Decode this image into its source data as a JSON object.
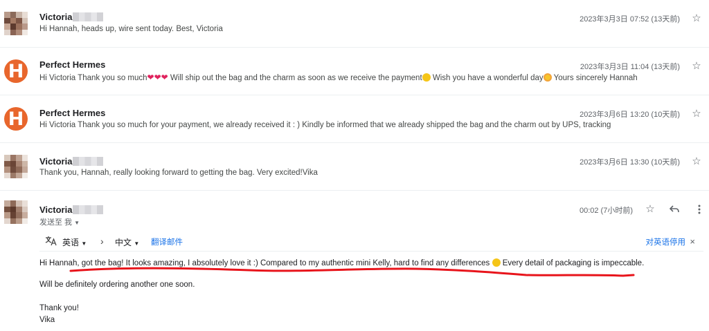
{
  "messages": [
    {
      "sender": "Victoria",
      "snippet": "Hi Hannah, heads up, wire sent today. Best, Victoria",
      "date": "2023年3月3日 07:52 (13天前)"
    },
    {
      "sender": "Perfect Hermes",
      "avatar_letter": "H",
      "snippet_a": "Hi Victoria Thank you so much",
      "snippet_b": " Will ship out the bag and the charm as soon as we receive the payment",
      "snippet_c": " Wish you have a wonderful day",
      "snippet_d": " Yours sincerely Hannah",
      "date": "2023年3月3日 11:04 (13天前)"
    },
    {
      "sender": "Perfect Hermes",
      "avatar_letter": "H",
      "snippet": "Hi Victoria Thank you so much for your payment, we already received it : ) Kindly be informed that we already shipped the bag and the charm out by UPS, tracking",
      "date": "2023年3月6日 13:20 (10天前)"
    },
    {
      "sender": "Victoria",
      "snippet": "Thank you, Hannah, really looking forward to getting the bag. Very excited!Vika",
      "date": "2023年3月6日 13:30 (10天前)"
    }
  ],
  "open_message": {
    "sender": "Victoria",
    "recipient": "发送至 我",
    "date": "00:02 (7小时前)",
    "translate": {
      "from_lang": "英语",
      "to_lang": "中文",
      "translate_link": "翻译邮件",
      "disable_link": "对英语停用",
      "close": "×"
    },
    "body_line1_a": "Hi Hannah, got the bag! It looks amazing, I absolutely love it :) Compared to my authentic mini Kelly, hard to find any differences",
    "body_line1_b": " Every detail of packaging is impeccable.",
    "body_line2": "Will be definitely ordering another one soon.",
    "body_line3": "Thank you!",
    "body_line4": "Vika"
  },
  "icons": {
    "star": "star-outline-icon",
    "reply": "reply-icon",
    "more": "more-vert-icon",
    "translate": "translate-icon"
  },
  "colors": {
    "avatar_orange": "#e8662c",
    "link_blue": "#1a73e8",
    "annotation_red": "#e8141b"
  }
}
